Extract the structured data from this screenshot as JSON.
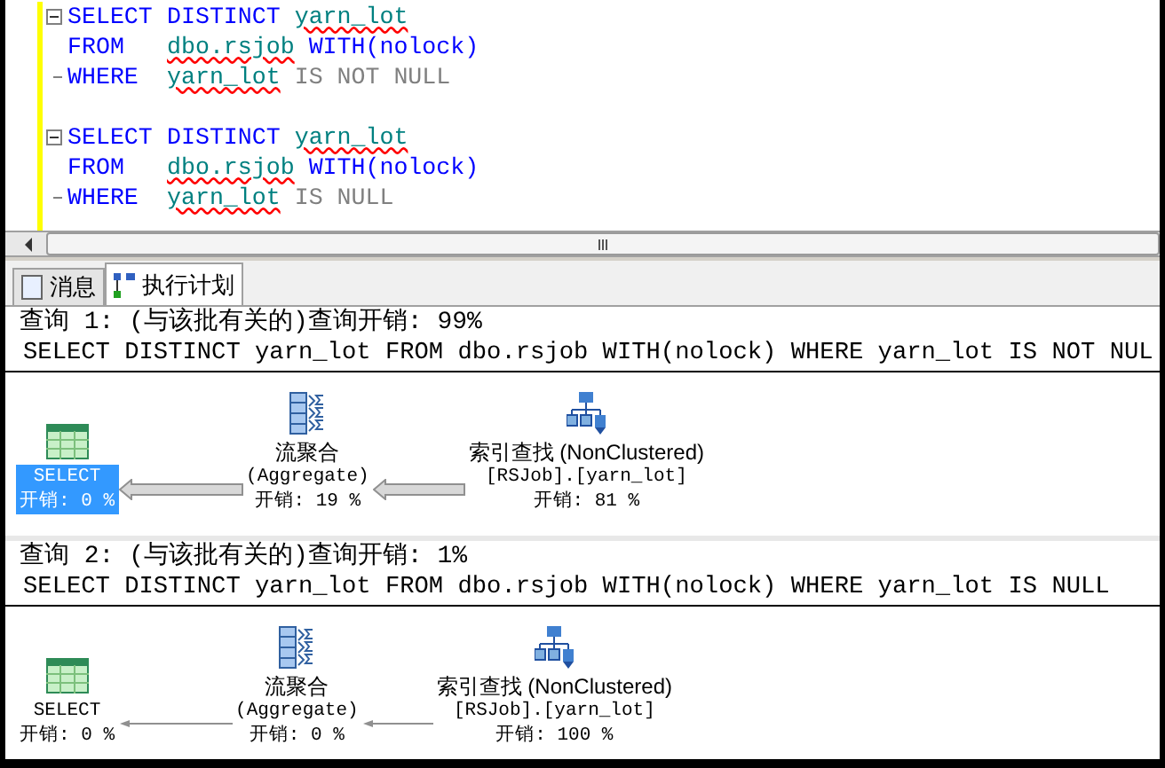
{
  "editor": {
    "statements": [
      {
        "lines": [
          {
            "fold_start": true,
            "fold_end": false,
            "tokens": [
              {
                "text": "SELECT",
                "kind": "keyword"
              },
              {
                "text": "DISTINCT",
                "kind": "keyword"
              },
              {
                "text": "yarn_lot",
                "kind": "identifier"
              }
            ]
          },
          {
            "fold_start": false,
            "fold_end": false,
            "tokens": [
              {
                "text": "FROM",
                "kind": "keyword"
              },
              {
                "text": "dbo.rsjob",
                "kind": "identifier"
              },
              {
                "text": "WITH(nolock)",
                "kind": "keyword"
              }
            ]
          },
          {
            "fold_start": false,
            "fold_end": true,
            "tokens": [
              {
                "text": "WHERE",
                "kind": "keyword"
              },
              {
                "text": "yarn_lot",
                "kind": "identifier"
              },
              {
                "text": "IS NOT NULL",
                "kind": "operator"
              }
            ]
          }
        ]
      },
      {
        "lines": [
          {
            "fold_start": true,
            "fold_end": false,
            "tokens": [
              {
                "text": "SELECT",
                "kind": "keyword"
              },
              {
                "text": "DISTINCT",
                "kind": "keyword"
              },
              {
                "text": "yarn_lot",
                "kind": "identifier"
              }
            ]
          },
          {
            "fold_start": false,
            "fold_end": false,
            "tokens": [
              {
                "text": "FROM",
                "kind": "keyword"
              },
              {
                "text": "dbo.rsjob",
                "kind": "identifier"
              },
              {
                "text": "WITH(nolock)",
                "kind": "keyword"
              }
            ]
          },
          {
            "fold_start": false,
            "fold_end": true,
            "tokens": [
              {
                "text": "WHERE",
                "kind": "keyword"
              },
              {
                "text": "yarn_lot",
                "kind": "identifier"
              },
              {
                "text": "IS NULL",
                "kind": "operator"
              }
            ]
          }
        ]
      }
    ]
  },
  "tabs": [
    {
      "label": "消息",
      "selected": false,
      "kind": "messages"
    },
    {
      "label": "执行计划",
      "selected": true,
      "kind": "plan"
    }
  ],
  "queries": [
    {
      "header": "查询 1: (与该批有关的)查询开销: 99%",
      "sql": "SELECT DISTINCT yarn_lot FROM dbo.rsjob WITH(nolock) WHERE yarn_lot IS NOT NUL",
      "thick_arrows": true,
      "nodes": [
        {
          "kind": "select",
          "lines": [
            "SELECT",
            "开销: 0 %"
          ],
          "selected": true
        },
        {
          "kind": "aggregate",
          "lines": [
            "流聚合",
            "(Aggregate)",
            "开销: 19 %"
          ],
          "selected": false
        },
        {
          "kind": "seek",
          "lines": [
            "索引查找 (NonClustered)",
            "[RSJob].[yarn_lot]",
            "开销: 81 %"
          ],
          "selected": false
        }
      ]
    },
    {
      "header": "查询 2: (与该批有关的)查询开销: 1%",
      "sql": "SELECT DISTINCT yarn_lot FROM dbo.rsjob WITH(nolock) WHERE yarn_lot IS NULL",
      "thick_arrows": false,
      "nodes": [
        {
          "kind": "select",
          "lines": [
            "SELECT",
            "开销: 0 %"
          ],
          "selected": false
        },
        {
          "kind": "aggregate",
          "lines": [
            "流聚合",
            "(Aggregate)",
            "开销: 0 %"
          ],
          "selected": false
        },
        {
          "kind": "seek",
          "lines": [
            "索引查找 (NonClustered)",
            "[RSJob].[yarn_lot]",
            "开销: 100 %"
          ],
          "selected": false
        }
      ]
    }
  ]
}
